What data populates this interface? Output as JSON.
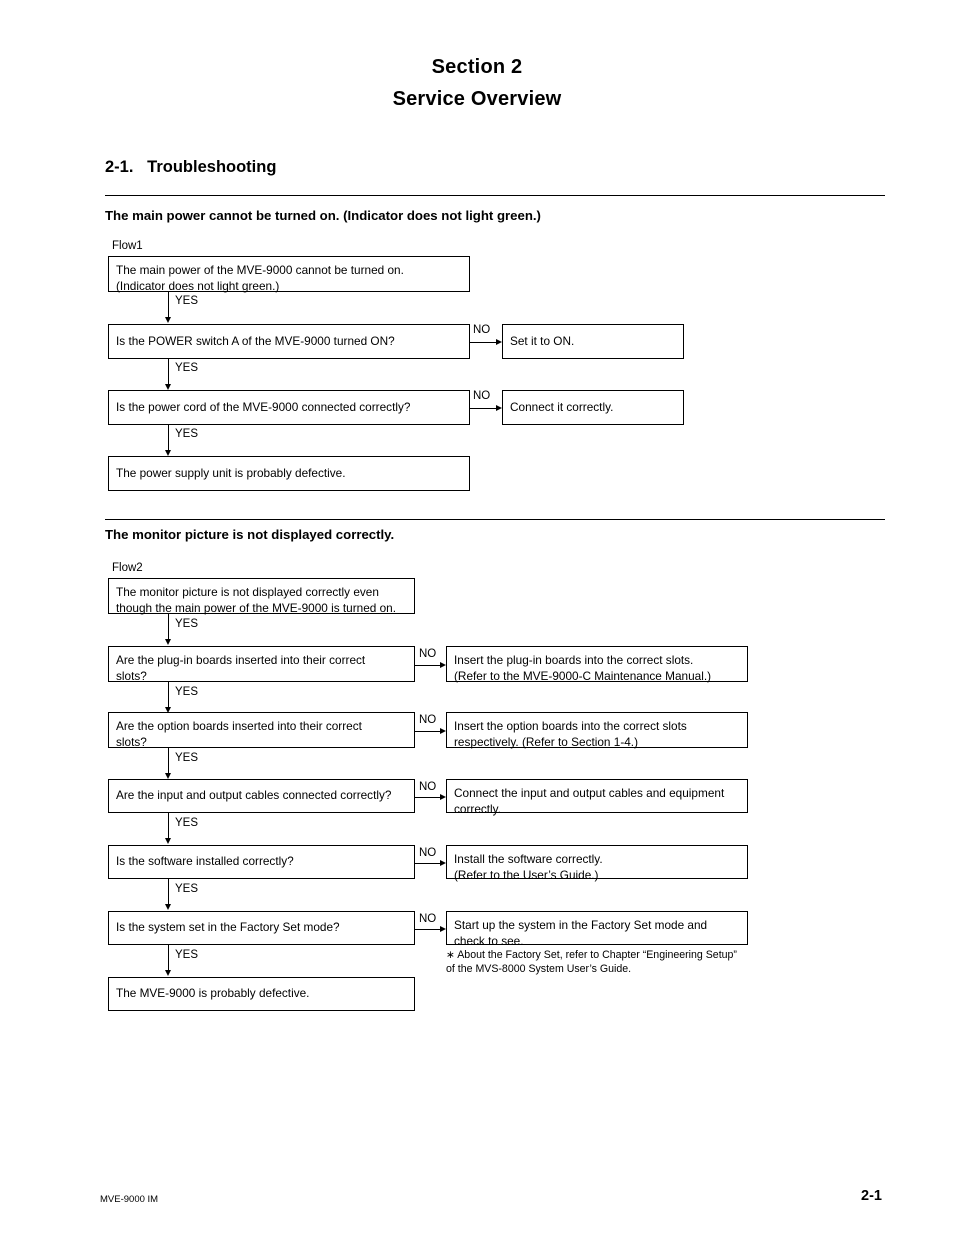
{
  "document": {
    "section_number": "Section 2",
    "section_title": "Service Overview",
    "heading": "2-1.   Troubleshooting"
  },
  "footer": {
    "left": "MVE-9000 IM",
    "page": "2-1"
  },
  "sections": [
    {
      "subheading": "The main power cannot be turned on. (Indicator does not light green.)",
      "flow_label": "Flow1",
      "yes_label": "YES",
      "no_label": "NO",
      "steps": [
        {
          "box": "The main power of the MVE-9000 cannot be turned on.\n(Indicator does not light green.)",
          "no_box": null
        },
        {
          "box": "Is the POWER switch A of the MVE-9000 turned ON?",
          "no_box": "Set it to ON."
        },
        {
          "box": "Is the power cord of the MVE-9000 connected correctly?",
          "no_box": "Connect it correctly."
        },
        {
          "box": "The power supply unit is probably defective.",
          "no_box": null
        }
      ]
    },
    {
      "subheading": "The monitor picture is not displayed correctly.",
      "flow_label": "Flow2",
      "yes_label": "YES",
      "no_label": "NO",
      "footnote": "∗ About the Factory Set, refer to Chapter “Engineering Setup”\n   of the MVS-8000 System User’s Guide.",
      "steps": [
        {
          "box": "The monitor picture is not displayed correctly even\nthough the main power of the MVE-9000 is turned on.",
          "no_box": null
        },
        {
          "box": "Are the plug-in boards inserted into their correct\nslots?",
          "no_box": "Insert the plug-in boards into the correct slots.\n(Refer to the MVE-9000-C Maintenance Manual.)"
        },
        {
          "box": "Are the option boards inserted into their correct\nslots?",
          "no_box": "Insert the option boards into the correct slots\nrespectively. (Refer to Section 1-4.)"
        },
        {
          "box": "Are the input and output cables connected correctly?",
          "no_box": "Connect the input and output cables and equipment\ncorrectly."
        },
        {
          "box": "Is the software installed correctly?",
          "no_box": "Install the software correctly.\n(Refer to the User’s Guide.)"
        },
        {
          "box": "Is the system set in the Factory Set mode?",
          "no_box": "Start up the system in the Factory Set mode and\ncheck to see."
        },
        {
          "box": "The MVE-9000 is probably defective.",
          "no_box": null
        }
      ]
    }
  ]
}
